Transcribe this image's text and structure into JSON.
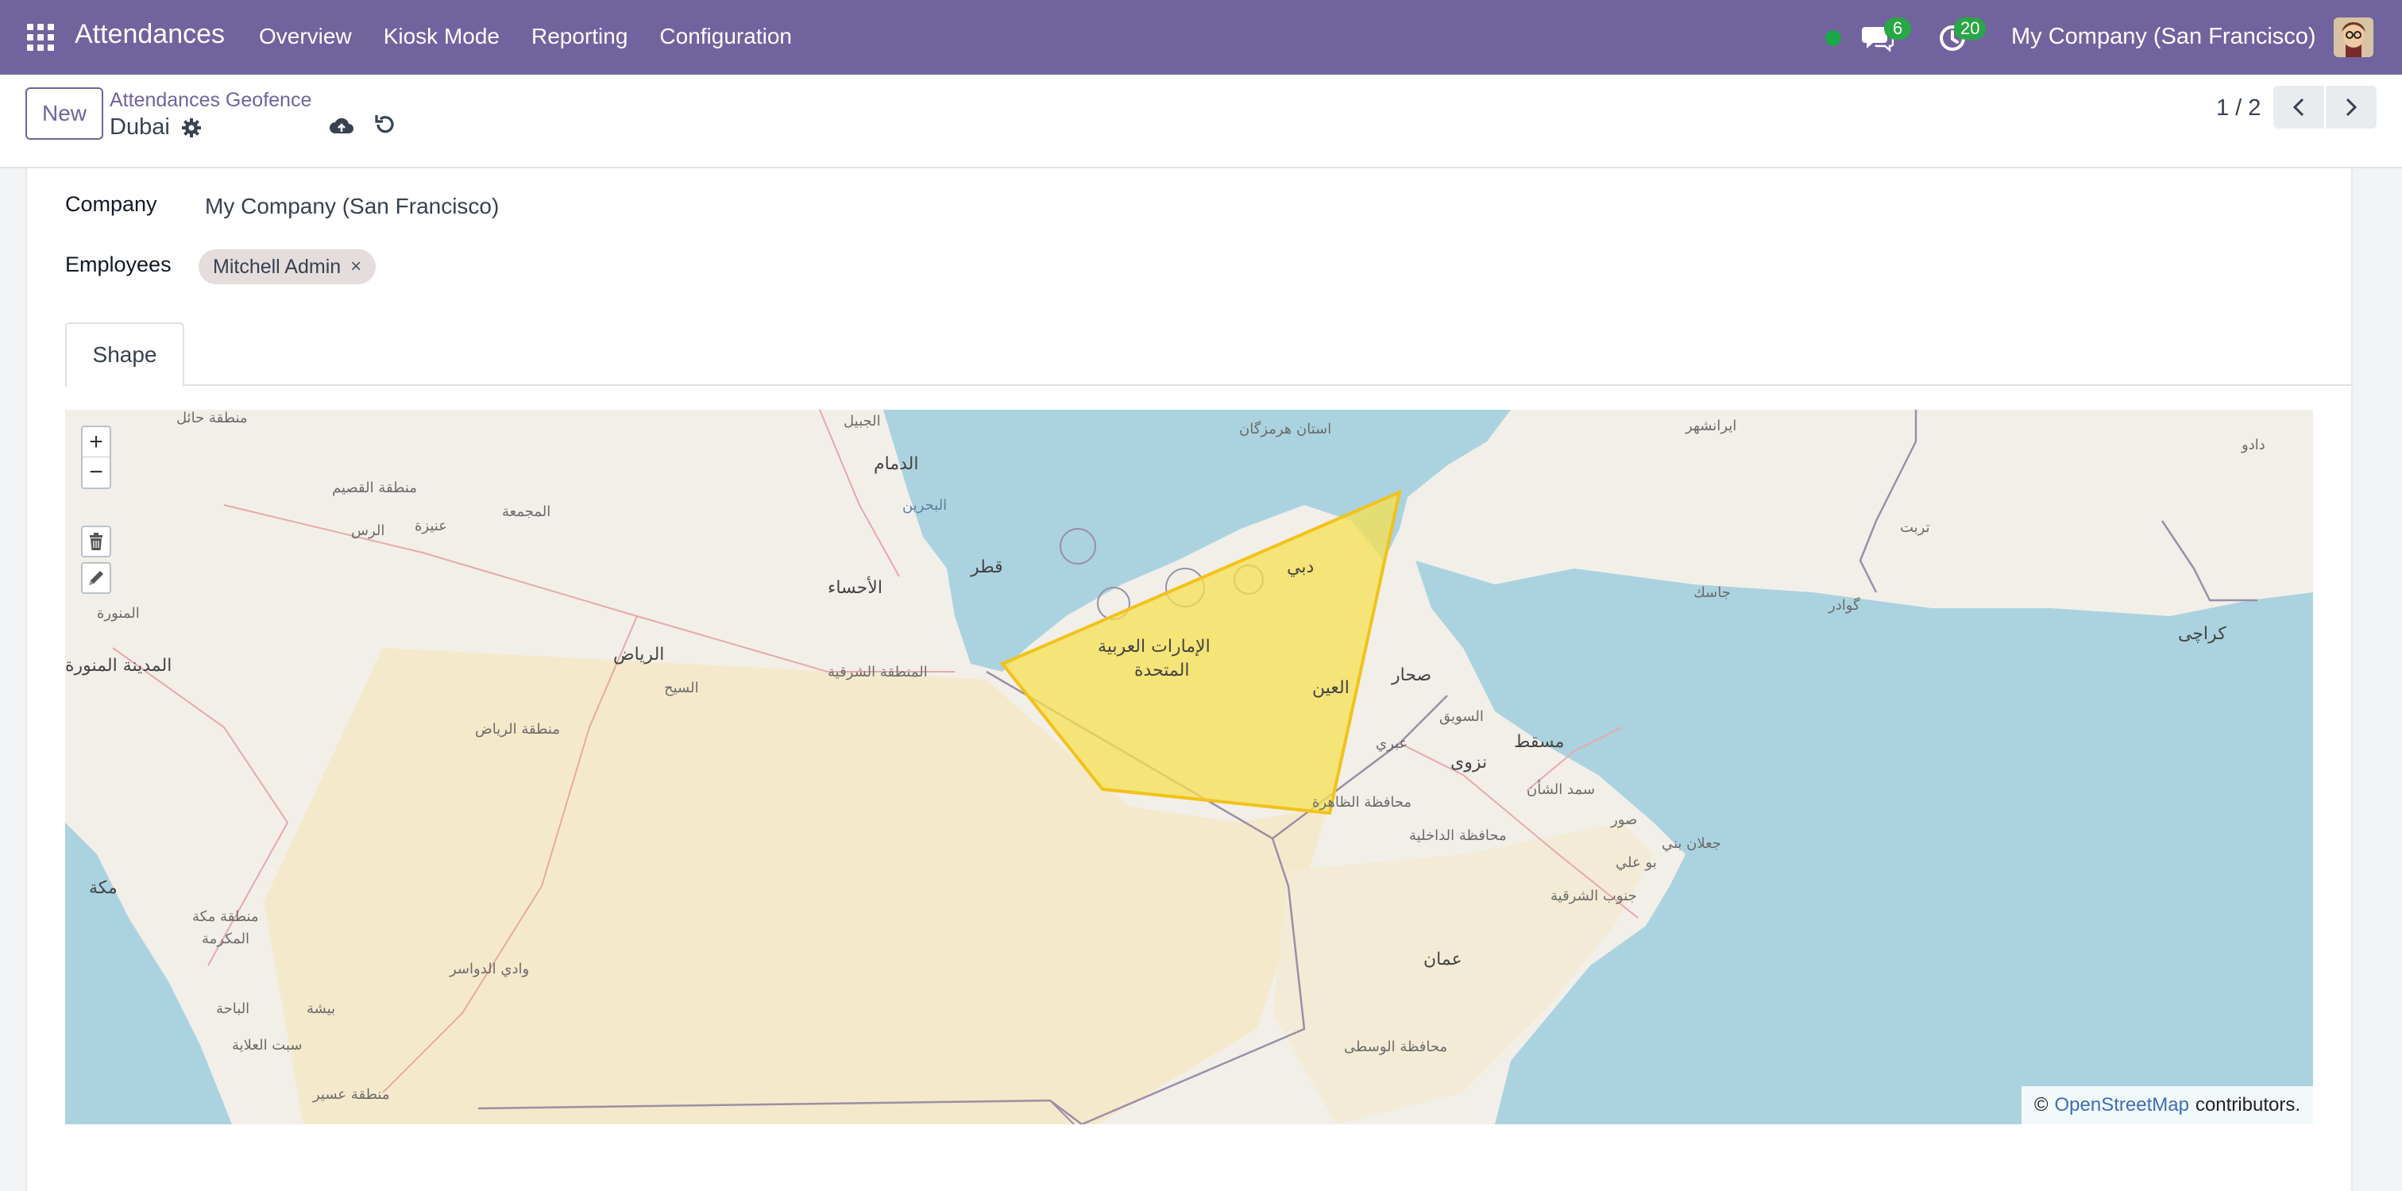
{
  "navbar": {
    "app_title": "Attendances",
    "menu": [
      "Overview",
      "Kiosk Mode",
      "Reporting",
      "Configuration"
    ],
    "chat_count": "6",
    "activity_count": "20",
    "company": "My Company (San Francisco)",
    "status_color": "#1aa84b",
    "brand_color": "#71639e"
  },
  "control_panel": {
    "new_label": "New",
    "breadcrumb": "Attendances Geofence",
    "record_name": "Dubai",
    "pager": "1 / 2"
  },
  "form": {
    "company_label": "Company",
    "company_value": "My Company (San Francisco)",
    "employees_label": "Employees",
    "employees": [
      "Mitchell Admin"
    ],
    "tag_remove": "×",
    "tabs": [
      "Shape"
    ]
  },
  "map": {
    "zoom_in": "+",
    "zoom_out": "−",
    "attribution_prefix": "©",
    "attribution_link": "OpenStreetMap",
    "attribution_suffix": "contributors.",
    "labels": [
      "منطقة حائل",
      "الجبيل",
      "الدمام",
      "البحرين",
      "قطر",
      "الأحساء",
      "منطقة القصيم",
      "المجمعة",
      "عنيزة",
      "الرس",
      "الرياض",
      "السيح",
      "المنطقة الشرقية",
      "منطقة الرياض",
      "المدينة المنورة",
      "المنورة",
      "مكة",
      "منطقة مكة",
      "المكرمة",
      "وادي الدواسر",
      "الباحة",
      "بيشة",
      "سبت العلاية",
      "منطقة عسير",
      "استان هرمزگان",
      "ايرانشهر",
      "دادو",
      "تربت",
      "جاسك",
      "گوادر",
      "كراچی",
      "الإمارات العربية",
      "المتحدة",
      "دبي",
      "العين",
      "صحار",
      "السويق",
      "مسقط",
      "عبري",
      "نزوى",
      "سمد الشأن",
      "صور",
      "جعلان بني",
      "بو علي",
      "جنوب الشرقية",
      "محافظة الظاهرة",
      "محافظة الداخلية",
      "عمان",
      "محافظة الوسطى"
    ],
    "geofence_color": "#f5e050"
  }
}
